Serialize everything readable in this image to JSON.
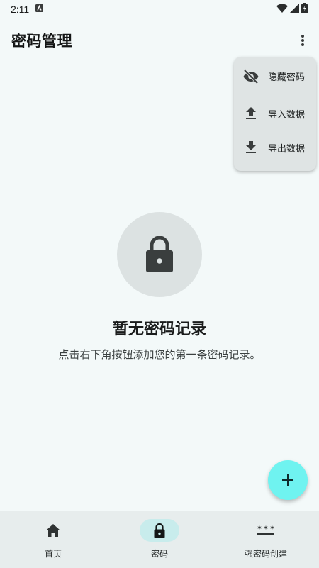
{
  "status": {
    "time": "2:11"
  },
  "app_bar": {
    "title": "密码管理"
  },
  "menu": {
    "items": [
      {
        "label": "隐藏密码",
        "icon": "eye-off-icon"
      },
      {
        "label": "导入数据",
        "icon": "upload-icon"
      },
      {
        "label": "导出数据",
        "icon": "download-icon"
      }
    ]
  },
  "empty_state": {
    "icon": "lock-icon",
    "title": "暂无密码记录",
    "subtitle": "点击右下角按钮添加您的第一条密码记录。"
  },
  "fab": {
    "icon": "plus-icon"
  },
  "bottom_nav": {
    "items": [
      {
        "label": "首页",
        "icon": "home-icon"
      },
      {
        "label": "密码",
        "icon": "lock-icon",
        "active": true
      },
      {
        "label": "强密码创建",
        "icon": "password-icon"
      }
    ]
  },
  "colors": {
    "background": "#f3f9f9",
    "menu_background": "#dfe4e4",
    "fab": "#6ff3f0",
    "nav_active_pill": "#c8ecec",
    "nav_background": "#e7eded"
  }
}
